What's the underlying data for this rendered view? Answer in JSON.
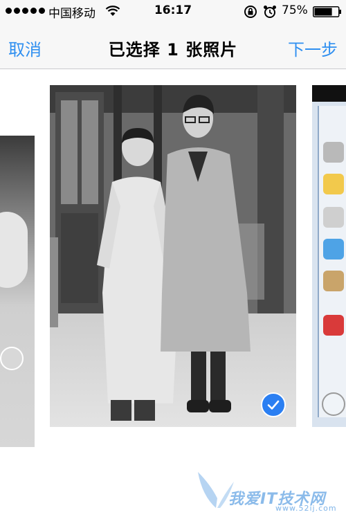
{
  "status_bar": {
    "carrier": "中国移动",
    "time": "16:17",
    "battery": "75%",
    "battery_level": 0.75
  },
  "nav": {
    "cancel_label": "取消",
    "title": "已选择 1 张照片",
    "next_label": "下一步"
  },
  "photos": {
    "selected_count": 1,
    "items": [
      {
        "position": "previous",
        "selected": false
      },
      {
        "position": "current",
        "selected": true
      },
      {
        "position": "next",
        "selected": false
      }
    ]
  },
  "watermark": {
    "text": "我爱IT技术网",
    "url": "www.52ij.com"
  },
  "colors": {
    "accent": "#2f8ff0",
    "bar_bg": "#f7f7f7",
    "check": "#2b7ff2"
  }
}
